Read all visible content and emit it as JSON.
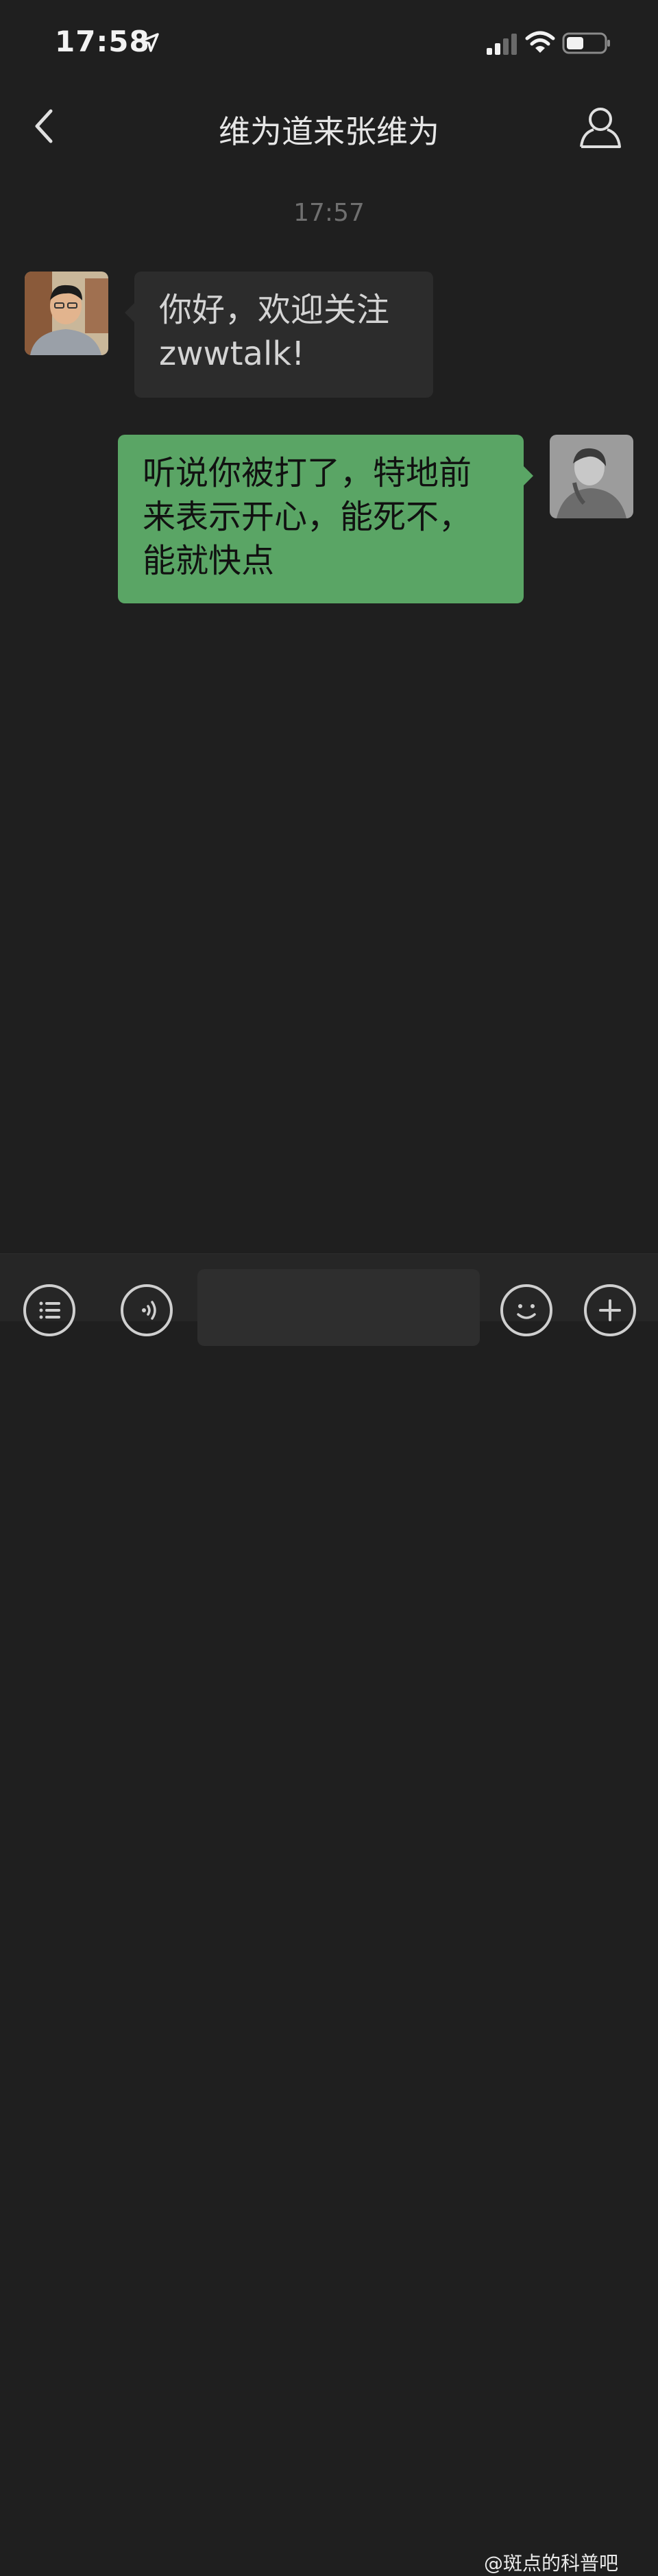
{
  "status_bar": {
    "time": "17:58",
    "icons": [
      "location-arrow-icon",
      "signal-icon",
      "wifi-icon",
      "battery-icon"
    ]
  },
  "nav_bar": {
    "title": "维为道来张维为",
    "icons": [
      "back-chevron-icon",
      "contact-person-icon"
    ]
  },
  "chat": {
    "timestamp": "17:57",
    "messages": [
      {
        "direction": "incoming",
        "text": "你好，欢迎关注zwwtalk!"
      },
      {
        "direction": "outgoing",
        "text": "听说你被打了，特地前来表示开心，能死不，能就快点"
      }
    ]
  },
  "input_bar": {
    "icons": [
      "menu-list-icon",
      "voice-icon",
      "emoji-icon",
      "plus-icon"
    ],
    "input_value": ""
  },
  "watermark": "@斑点的科普吧",
  "colors": {
    "background": "#1f1f1f",
    "incoming_bubble": "#2c2c2c",
    "outgoing_bubble": "#5aa565"
  }
}
